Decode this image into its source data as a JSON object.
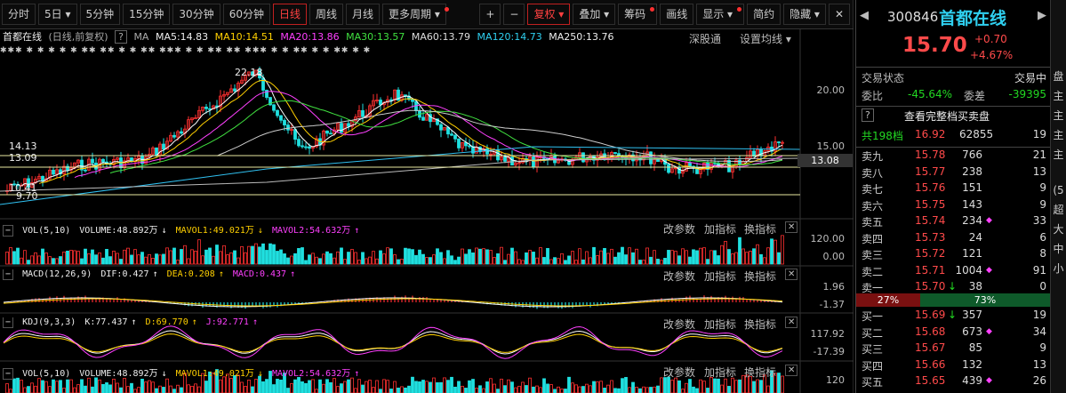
{
  "toolbar": {
    "items": [
      "分时",
      "5日",
      "5分钟",
      "15分钟",
      "30分钟",
      "60分钟",
      "日线",
      "周线",
      "月线",
      "更多周期"
    ],
    "right_items": [
      "+",
      "−",
      "复权",
      "叠加",
      "筹码",
      "画线",
      "显示",
      "简约",
      "隐藏"
    ],
    "close": "✕"
  },
  "header": {
    "name": "首都在线",
    "mode": "(日线,前复权)",
    "help": "?",
    "ma": "MA",
    "ma5": "MA5:14.83",
    "ma10": "MA10:14.51",
    "ma20": "MA20:13.86",
    "ma30": "MA30:13.57",
    "ma60": "MA60:13.79",
    "ma120": "MA120:14.73",
    "ma250": "MA250:13.76",
    "deep": "深股通",
    "setma": "设置均线"
  },
  "stars": "✱✱✱   ✱      ✱        ✱        ✱      ✱   ✱✱   ✱✱  ✱       ✱        ✱✱   ✱✱✱  ✱     ✱        ✱✱   ✱✱  ✱✱✱   ✱        ✱  ✱✱  ✱   ✱     ✱✱      ✱     ✱",
  "main_chart": {
    "price_labels": [
      "20.00",
      "15.00"
    ],
    "high_label": "22.18",
    "left_labels": [
      "14.13",
      "13.09",
      "10.41",
      "9.70"
    ],
    "current_tag": "13.08"
  },
  "panels": [
    {
      "title": "VOL(5,10)",
      "v1": "VOLUME:48.892万",
      "v2": "MAVOL1:49.021万",
      "v3": "MAVOL2:54.632万",
      "axis": [
        "120.00",
        "0.00"
      ]
    },
    {
      "title": "MACD(12,26,9)",
      "v1": "DIF:0.427",
      "v2": "DEA:0.208",
      "v3": "MACD:0.437",
      "axis": [
        "1.96",
        "-1.37"
      ]
    },
    {
      "title": "KDJ(9,3,3)",
      "v1": "K:77.437",
      "v2": "D:69.770",
      "v3": "J:92.771",
      "axis": [
        "117.92",
        "-17.39"
      ]
    },
    {
      "title": "VOL(5,10)",
      "v1": "VOLUME:48.892万",
      "v2": "MAVOL1:49.021万",
      "v3": "MAVOL2:54.632万",
      "axis": [
        "120"
      ]
    }
  ],
  "panel_buttons": {
    "params": "改参数",
    "add": "加指标",
    "switch": "换指标",
    "close": "✕"
  },
  "quote": {
    "code": "300846",
    "name": "首都在线",
    "price": "15.70",
    "change": "+0.70",
    "change_pct": "+4.67%",
    "status_label": "交易状态",
    "status": "交易中",
    "weibi_label": "委比",
    "weibi": "-45.64%",
    "weicha_label": "委差",
    "weicha": "-39395",
    "full_book": "查看完整档买卖盘",
    "total_label": "共198档",
    "total_price": "16.92",
    "total_vol": "62855",
    "total_n": "19",
    "sells": [
      {
        "label": "卖九",
        "price": "15.78",
        "vol": "766",
        "n": "21",
        "mark": ""
      },
      {
        "label": "卖八",
        "price": "15.77",
        "vol": "238",
        "n": "13",
        "mark": ""
      },
      {
        "label": "卖七",
        "price": "15.76",
        "vol": "151",
        "n": "9",
        "mark": ""
      },
      {
        "label": "卖六",
        "price": "15.75",
        "vol": "143",
        "n": "9",
        "mark": ""
      },
      {
        "label": "卖五",
        "price": "15.74",
        "vol": "234",
        "n": "33",
        "mark": "◆"
      },
      {
        "label": "卖四",
        "price": "15.73",
        "vol": "24",
        "n": "6",
        "mark": ""
      },
      {
        "label": "卖三",
        "price": "15.72",
        "vol": "121",
        "n": "8",
        "mark": ""
      },
      {
        "label": "卖二",
        "price": "15.71",
        "vol": "1004",
        "n": "91",
        "mark": "◆"
      },
      {
        "label": "卖一",
        "price": "15.70",
        "vol": "38",
        "n": "0",
        "mark": "↓"
      }
    ],
    "ratio_left": "27%",
    "ratio_right": "73%",
    "buys": [
      {
        "label": "买一",
        "price": "15.69",
        "vol": "357",
        "n": "19",
        "mark": "↓"
      },
      {
        "label": "买二",
        "price": "15.68",
        "vol": "673",
        "n": "34",
        "mark": "◆"
      },
      {
        "label": "买三",
        "price": "15.67",
        "vol": "85",
        "n": "9",
        "mark": ""
      },
      {
        "label": "买四",
        "price": "15.66",
        "vol": "132",
        "n": "13",
        "mark": ""
      },
      {
        "label": "买五",
        "price": "15.65",
        "vol": "439",
        "n": "26",
        "mark": "◆"
      }
    ]
  },
  "edge_tabs": [
    "盘",
    "主",
    "主",
    "主",
    "主",
    "(5",
    "超",
    "大",
    "中",
    "小"
  ]
}
